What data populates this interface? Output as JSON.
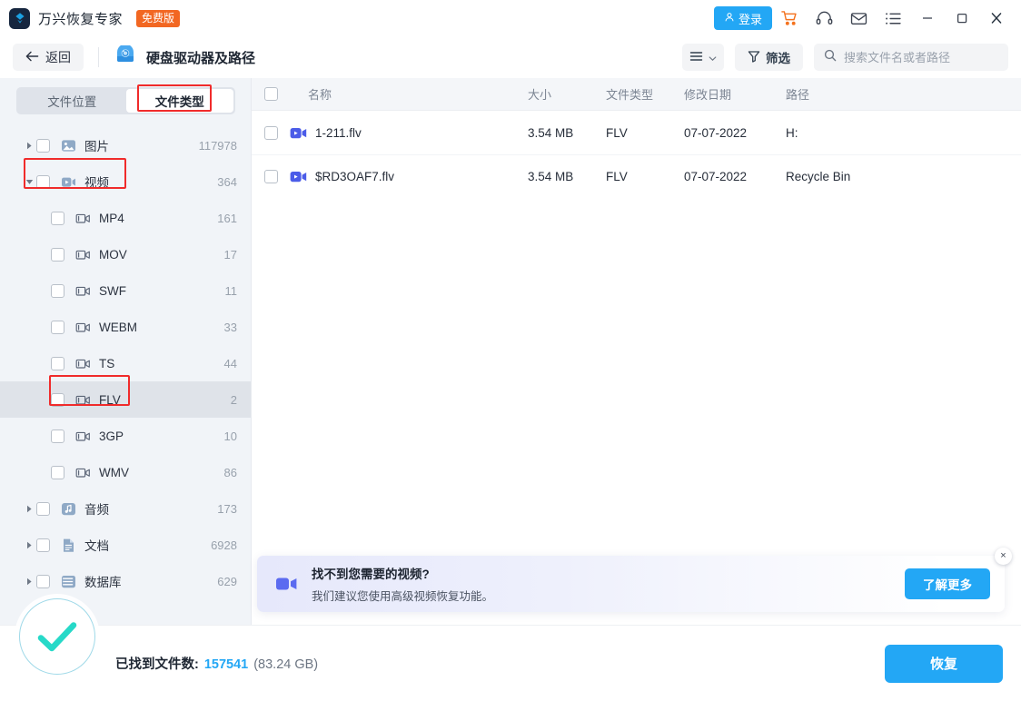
{
  "titlebar": {
    "brand_name": "万兴恢复专家",
    "badge": "免费版",
    "login_label": "登录",
    "icons": {
      "cart": "cart-icon",
      "headset": "headset-icon",
      "mail": "mail-icon",
      "list": "list-menu-icon",
      "minimize": "minimize-icon",
      "maximize": "maximize-icon",
      "close": "close-icon"
    }
  },
  "subheader": {
    "back_label": "返回",
    "drive_title": "硬盘驱动器及路径",
    "filter_label": "筛选",
    "search_placeholder": "搜索文件名或者路径",
    "search_value": ""
  },
  "sidebar": {
    "tabs": [
      {
        "label": "文件位置",
        "active": false
      },
      {
        "label": "文件类型",
        "active": true
      }
    ],
    "tree": [
      {
        "label": "图片",
        "count": "117978",
        "level": 0,
        "icon": "image-icon",
        "caret": "right",
        "selected": false
      },
      {
        "label": "视频",
        "count": "364",
        "level": 0,
        "icon": "video-icon",
        "caret": "down",
        "selected": false
      },
      {
        "label": "MP4",
        "count": "161",
        "level": 1,
        "icon": "video-file-icon",
        "caret": "none",
        "selected": false
      },
      {
        "label": "MOV",
        "count": "17",
        "level": 1,
        "icon": "video-file-icon",
        "caret": "none",
        "selected": false
      },
      {
        "label": "SWF",
        "count": "11",
        "level": 1,
        "icon": "video-file-icon",
        "caret": "none",
        "selected": false
      },
      {
        "label": "WEBM",
        "count": "33",
        "level": 1,
        "icon": "video-file-icon",
        "caret": "none",
        "selected": false
      },
      {
        "label": "TS",
        "count": "44",
        "level": 1,
        "icon": "video-file-icon",
        "caret": "none",
        "selected": false
      },
      {
        "label": "FLV",
        "count": "2",
        "level": 1,
        "icon": "video-file-icon",
        "caret": "none",
        "selected": true
      },
      {
        "label": "3GP",
        "count": "10",
        "level": 1,
        "icon": "video-file-icon",
        "caret": "none",
        "selected": false
      },
      {
        "label": "WMV",
        "count": "86",
        "level": 1,
        "icon": "video-file-icon",
        "caret": "none",
        "selected": false
      },
      {
        "label": "音频",
        "count": "173",
        "level": 0,
        "icon": "audio-icon",
        "caret": "right",
        "selected": false
      },
      {
        "label": "文档",
        "count": "6928",
        "level": 0,
        "icon": "document-icon",
        "caret": "right",
        "selected": false
      },
      {
        "label": "数据库",
        "count": "629",
        "level": 0,
        "icon": "database-icon",
        "caret": "right",
        "selected": false
      }
    ]
  },
  "table": {
    "headers": {
      "name": "名称",
      "size": "大小",
      "type": "文件类型",
      "date": "修改日期",
      "path": "路径"
    },
    "rows": [
      {
        "name": "1-211.flv",
        "size": "3.54 MB",
        "type": "FLV",
        "date": "07-07-2022",
        "path": "H:"
      },
      {
        "name": "$RD3OAF7.flv",
        "size": "3.54 MB",
        "type": "FLV",
        "date": "07-07-2022",
        "path": "Recycle Bin"
      }
    ]
  },
  "banner": {
    "title": "找不到您需要的视频?",
    "subtitle": "我们建议您使用高级视频恢复功能。",
    "button": "了解更多",
    "close": "×"
  },
  "footer": {
    "found_label": "已找到文件数:",
    "found_count": "157541",
    "found_size": "(83.24 GB)",
    "recover_label": "恢复"
  },
  "colors": {
    "accent_blue": "#23a7f5",
    "badge_orange": "#f26722",
    "cart_orange": "#f4721e",
    "check_teal": "#27d9c8",
    "annotation_red": "#f02b2b",
    "video_file_blue": "#4b5ce8",
    "sidebar_bg": "#f1f4f8"
  }
}
